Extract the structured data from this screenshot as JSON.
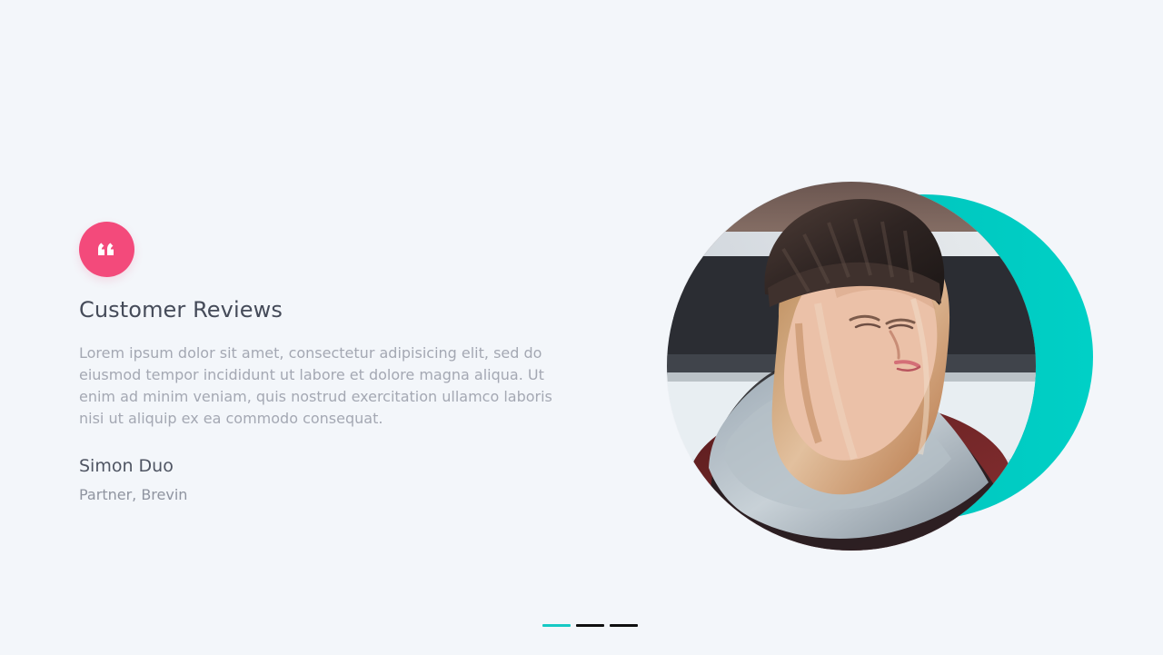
{
  "review": {
    "badge_icon": "quote-icon",
    "title": "Customer Reviews",
    "body": "Lorem ipsum dolor sit amet, consectetur adipisicing elit, sed do eiusmod tempor incididunt ut labore et dolore magna aliqua. Ut enim ad minim veniam, quis nostrud exercitation ullamco laboris nisi ut aliquip ex ea commodo consequat.",
    "name": "Simon Duo",
    "role": "Partner, Brevin"
  },
  "media": {
    "portrait_icon": "woman-portrait",
    "accent_shape": "teal-circle"
  },
  "pagination": {
    "active_index": 0,
    "count": 3
  },
  "colors": {
    "background": "#f3f6fa",
    "badge": "#f34a7b",
    "accent": "#00c7bf",
    "title": "#454b59",
    "body": "#a4a8b3",
    "role": "#8f94a0",
    "pagination_inactive": "#0f0f10"
  }
}
